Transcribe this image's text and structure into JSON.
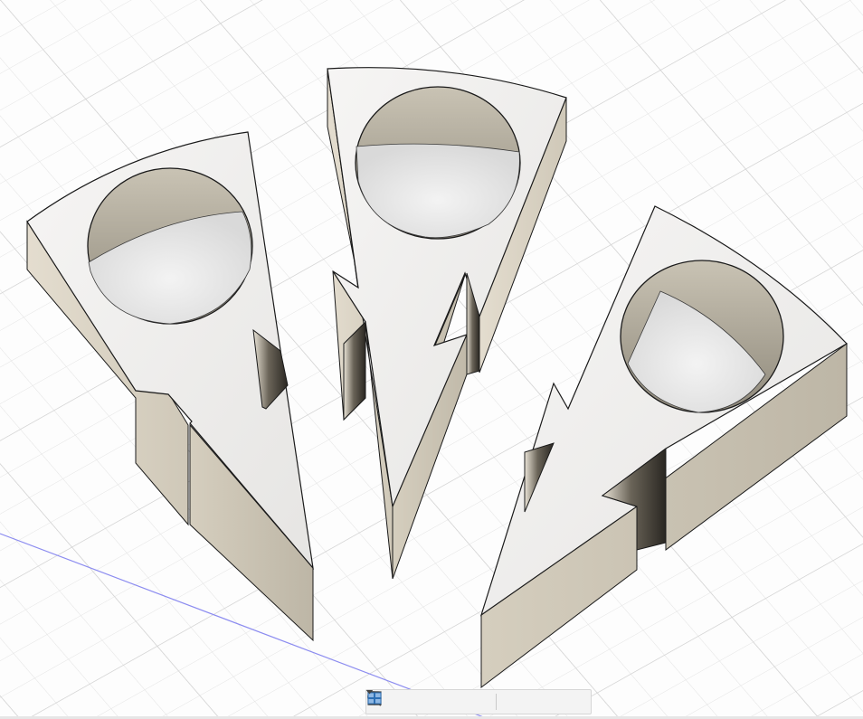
{
  "app": {
    "view": "3D model canvas",
    "model_parts": [
      {
        "name": "left-wedge"
      },
      {
        "name": "center-wedge"
      },
      {
        "name": "right-wedge"
      }
    ]
  },
  "colors": {
    "background": "#fdfdfd",
    "grid_minor": "#e7e7e7",
    "grid_major": "#d2d2d2",
    "axis_line": "#8c8cf0",
    "top_face": "#ecebea",
    "side_face": "#d9d3c5",
    "outline": "#1a1a1a",
    "toolbar_bg": "#f3f3f3",
    "icon_blue": "#2c6fb5"
  },
  "navigation_bar": {
    "tools": [
      {
        "name": "orbit-icon",
        "has_menu": true
      },
      {
        "name": "look-at-icon",
        "has_menu": false
      },
      {
        "name": "pan-icon",
        "has_menu": false
      },
      {
        "name": "zoom-icon",
        "has_menu": false
      },
      {
        "name": "zoom-window-icon",
        "has_menu": true
      },
      {
        "name": "display-settings-icon",
        "has_menu": true
      },
      {
        "name": "grid-snaps-icon",
        "has_menu": true
      },
      {
        "name": "viewports-icon",
        "has_menu": true
      }
    ]
  }
}
